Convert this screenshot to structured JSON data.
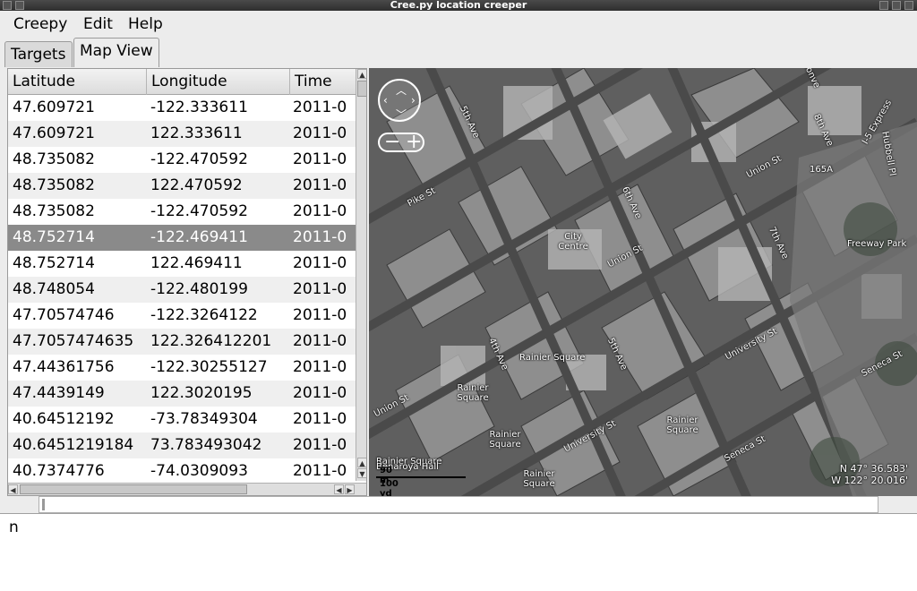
{
  "window": {
    "title": "Cree.py location creeper"
  },
  "menu": [
    "Creepy",
    "Edit",
    "Help"
  ],
  "tabs": [
    {
      "label": "Targets",
      "active": false
    },
    {
      "label": "Map View",
      "active": true
    }
  ],
  "table": {
    "columns": [
      "Latitude",
      "Longitude",
      "Time"
    ],
    "selected_index": 5,
    "rows": [
      [
        "47.609721",
        "-122.333611",
        "2011-0"
      ],
      [
        "47.609721",
        "122.333611",
        "2011-0"
      ],
      [
        "48.735082",
        "-122.470592",
        "2011-0"
      ],
      [
        "48.735082",
        "122.470592",
        "2011-0"
      ],
      [
        "48.735082",
        "-122.470592",
        "2011-0"
      ],
      [
        "48.752714",
        "-122.469411",
        "2011-0"
      ],
      [
        "48.752714",
        "122.469411",
        "2011-0"
      ],
      [
        "48.748054",
        "-122.480199",
        "2011-0"
      ],
      [
        "47.70574746",
        "-122.3264122",
        "2011-0"
      ],
      [
        "47.7057474635",
        "122.326412201",
        "2011-0"
      ],
      [
        "47.44361756",
        "-122.30255127",
        "2011-0"
      ],
      [
        "47.4439149",
        "122.3020195",
        "2011-0"
      ],
      [
        "40.64512192",
        "-73.78349304",
        "2011-0"
      ],
      [
        "40.6451219184",
        "73.783493042",
        "2011-0"
      ],
      [
        "40.7374776",
        "-74.0309093",
        "2011-0"
      ]
    ]
  },
  "map": {
    "labels": {
      "pike_st": "Pike St",
      "fifth_ave_top": "5th Ave",
      "sixth_ave": "6th Ave",
      "union_st_mid": "Union St",
      "union_st_right": "Union St",
      "city_centre": "City Centre",
      "eighth_ave": "8th Ave",
      "seventh_ave": "7th Ave",
      "freeway_park": "Freeway Park",
      "hubbell_pl": "Hubbell Pl",
      "i5_express": "I-5 Express",
      "exit_165a": "165A",
      "university_st_right": "University St",
      "seneca_st_right": "Seneca St",
      "rainier_square_1": "Rainier Square",
      "rainier_square_2": "Rainier Square",
      "rainier_square_3": "Rainier Square",
      "rainier_square_4": "Rainier Square",
      "rainier_square_5": "Rainier Square",
      "rainier_square_6": "Rainier Square",
      "fourth_ave": "4th Ave",
      "fifth_ave_bottom": "5th Ave",
      "union_st_left": "Union St",
      "university_st_bottom": "University St",
      "seneca_st_bottom": "Seneca St",
      "benaroya_hall": "Benaroya Hall",
      "conve": "Conve"
    },
    "scale": {
      "meters": "90 m",
      "yards": "100 yd"
    },
    "coords": {
      "lat": "N 47° 36.583'",
      "lon": "W 122° 20.016'"
    }
  },
  "output": {
    "text": "n"
  }
}
